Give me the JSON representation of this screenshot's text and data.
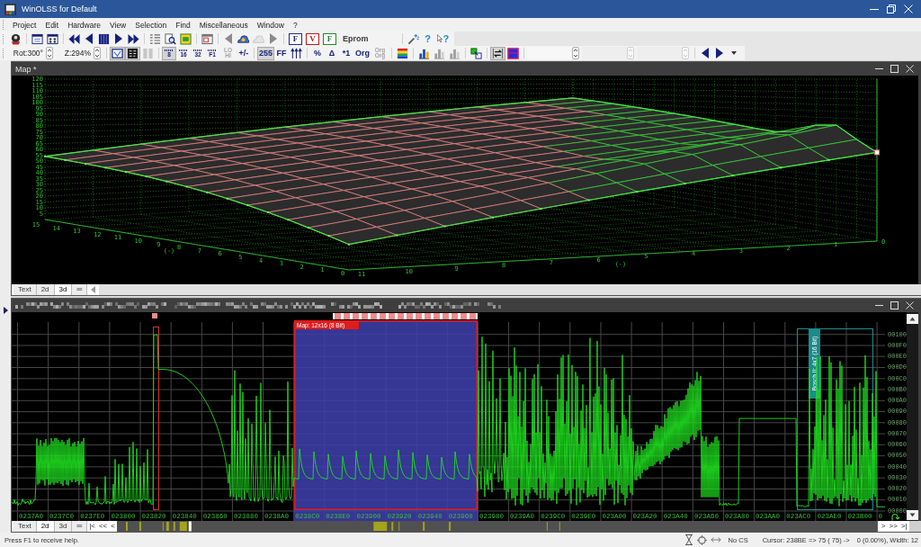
{
  "window": {
    "title": "WinOLSS for Default"
  },
  "menu": [
    "Project",
    "Edit",
    "Hardware",
    "View",
    "Selection",
    "Find",
    "Miscellaneous",
    "Window",
    "?"
  ],
  "toolbar_top": {
    "groups": [
      {
        "items": [
          {
            "kind": "icon",
            "pressed": false,
            "disabled": false
          }
        ]
      },
      {
        "items": [
          {
            "kind": "icon",
            "pressed": false,
            "disabled": false
          },
          {
            "kind": "icon",
            "pressed": false,
            "disabled": false
          }
        ]
      },
      {
        "items": [
          {
            "kind": "icon",
            "pressed": false,
            "disabled": false
          },
          {
            "kind": "icon",
            "pressed": false,
            "disabled": false
          },
          {
            "kind": "icon",
            "pressed": false,
            "disabled": false
          },
          {
            "kind": "icon",
            "pressed": false,
            "disabled": false
          },
          {
            "kind": "icon",
            "pressed": false,
            "disabled": false
          }
        ]
      },
      {
        "items": [
          {
            "kind": "icon",
            "pressed": false,
            "disabled": false
          },
          {
            "kind": "icon",
            "pressed": false,
            "disabled": false
          },
          {
            "kind": "icon",
            "pressed": false,
            "disabled": false
          }
        ]
      },
      {
        "items": [
          {
            "kind": "icon",
            "pressed": false,
            "disabled": false
          }
        ]
      },
      {
        "items": [
          {
            "kind": "icon",
            "pressed": false,
            "disabled": true
          },
          {
            "kind": "icon",
            "pressed": false,
            "disabled": false
          },
          {
            "kind": "icon",
            "pressed": false,
            "disabled": true
          },
          {
            "kind": "icon",
            "pressed": false,
            "disabled": true
          }
        ]
      },
      {
        "items": [
          {
            "kind": "letter",
            "label": "F",
            "color": "#1a2a8a",
            "pressed": false
          },
          {
            "kind": "letter",
            "label": "V",
            "color": "#c01818",
            "pressed": false
          },
          {
            "kind": "letter",
            "label": "F",
            "color": "#188a28",
            "pressed": false
          },
          {
            "kind": "text",
            "label": "Eprom"
          }
        ]
      },
      {
        "items": [
          {
            "kind": "icon",
            "pressed": false,
            "disabled": false
          },
          {
            "kind": "help",
            "label": "?",
            "pressed": false,
            "disabled": false
          },
          {
            "kind": "pointer_help",
            "label": "?",
            "pressed": false,
            "disabled": false
          }
        ]
      }
    ]
  },
  "toolbar_bottom": {
    "groups": [
      {
        "items": [
          {
            "kind": "spinner",
            "label": "Rot:300°",
            "disabled": false
          },
          {
            "kind": "spinner",
            "label": "Z:294%",
            "disabled": false
          }
        ]
      },
      {
        "items": [
          {
            "kind": "icon",
            "pressed": true,
            "disabled": false
          },
          {
            "kind": "icon",
            "pressed": true,
            "disabled": false
          },
          {
            "kind": "icon",
            "pressed": false,
            "disabled": true
          }
        ]
      },
      {
        "items": [
          {
            "kind": "bits",
            "label": "8",
            "pressed": true,
            "disabled": false
          },
          {
            "kind": "bits",
            "label": "16",
            "pressed": false,
            "disabled": false
          },
          {
            "kind": "bits",
            "label": "32",
            "pressed": false,
            "disabled": false
          },
          {
            "kind": "bits",
            "label": "F1",
            "pressed": false,
            "disabled": false
          },
          {
            "kind": "small",
            "label": "LO HI",
            "pressed": false,
            "disabled": true
          },
          {
            "kind": "symbol",
            "label": "+/-",
            "pressed": false,
            "disabled": false
          }
        ]
      },
      {
        "items": [
          {
            "kind": "symbol",
            "label": "255",
            "pressed": true,
            "disabled": false
          },
          {
            "kind": "symbol",
            "label": "FF",
            "pressed": false,
            "disabled": false
          },
          {
            "kind": "icon",
            "pressed": false,
            "disabled": false
          }
        ]
      },
      {
        "items": [
          {
            "kind": "symbol",
            "label": "%",
            "pressed": false,
            "disabled": false
          },
          {
            "kind": "symbol",
            "label": "Δ",
            "pressed": false,
            "disabled": false
          },
          {
            "kind": "symbol",
            "label": "*1",
            "pressed": false,
            "disabled": false
          },
          {
            "kind": "symbol",
            "label": "Org",
            "pressed": false,
            "disabled": false
          },
          {
            "kind": "small",
            "label": "Org Org",
            "pressed": false,
            "disabled": true
          }
        ]
      },
      {
        "items": [
          {
            "kind": "icon",
            "pressed": false,
            "disabled": false
          }
        ]
      },
      {
        "items": [
          {
            "kind": "icon",
            "pressed": false,
            "disabled": false
          },
          {
            "kind": "icon",
            "pressed": false,
            "disabled": true
          },
          {
            "kind": "icon",
            "pressed": false,
            "disabled": true
          }
        ]
      },
      {
        "items": [
          {
            "kind": "icon",
            "pressed": false,
            "disabled": false
          }
        ]
      },
      {
        "items": [
          {
            "kind": "icon",
            "pressed": true,
            "disabled": false
          },
          {
            "kind": "icon",
            "pressed": false,
            "disabled": false
          }
        ]
      },
      {
        "items": [
          {
            "kind": "spinner",
            "disabled": false
          },
          {
            "kind": "spinner",
            "disabled": true
          },
          {
            "kind": "spinner",
            "disabled": true
          }
        ]
      },
      {
        "items": [
          {
            "kind": "icon",
            "pressed": false,
            "disabled": false
          },
          {
            "kind": "icon",
            "pressed": false,
            "disabled": false
          },
          {
            "kind": "icon",
            "pressed": false,
            "disabled": false
          }
        ]
      }
    ]
  },
  "map_window": {
    "title": "Map *",
    "surface_plot": {
      "z_ticks": [
        "120",
        "115",
        "110",
        "105",
        "100",
        "95",
        "90",
        "85",
        "80",
        "75",
        "70",
        "65",
        "60",
        "55",
        "50",
        "45",
        "40",
        "35",
        "30",
        "25",
        "20",
        "15",
        "10",
        "5"
      ],
      "left_ticks": [
        "15",
        "14",
        "13",
        "12",
        "11",
        "10",
        "9",
        "8",
        "7",
        "6",
        "5",
        "4",
        "3",
        "2",
        "1",
        "0"
      ],
      "left_title": "(-)",
      "right_ticks": [
        "11",
        "10",
        "9",
        "8",
        "7",
        "6",
        "5",
        "4",
        "3",
        "2",
        "1",
        "0"
      ],
      "right_title": "(-)"
    },
    "tabs": [
      {
        "label": "Text",
        "selected": false
      },
      {
        "label": "2d",
        "selected": false
      },
      {
        "label": "3d",
        "selected": true
      },
      {
        "label": "═",
        "selected": false
      }
    ]
  },
  "hex_window": {
    "graph": {
      "maps": [
        {
          "kind": "selection",
          "label": "Map: 12x16 (8 Bit)"
        },
        {
          "kind": "outline",
          "label": "Bosch II: 4x7 (16 Bit)"
        }
      ],
      "y_ticks": [
        "00100",
        "000F0",
        "000E0",
        "000D0",
        "000C0",
        "000B0",
        "000A0",
        "00090",
        "00080",
        "00070",
        "00060",
        "00050",
        "00040",
        "00030",
        "00020",
        "00010",
        "00000"
      ],
      "x_ticks": [
        "0237A0",
        "0237C0",
        "0237E0",
        "023800",
        "023820",
        "023840",
        "023860",
        "023880",
        "0238A0",
        "0238C0",
        "0238E0",
        "023900",
        "023920",
        "023940",
        "023960",
        "023980",
        "0239A0",
        "0239C0",
        "0239E0",
        "023A00",
        "023A20",
        "023A40",
        "023A60",
        "023A80",
        "023AA0",
        "023AC0",
        "023AE0",
        "023B00",
        "0"
      ]
    },
    "tabs": [
      {
        "label": "Text",
        "selected": false
      },
      {
        "label": "2d",
        "selected": true
      },
      {
        "label": "3d",
        "selected": false
      },
      {
        "label": "═",
        "selected": false
      }
    ],
    "nav_left": [
      "|<",
      "<<",
      "<"
    ],
    "nav_right": [
      ">",
      ">>",
      ">|"
    ]
  },
  "status_bar": {
    "help": "Press F1 to receive help.",
    "checksum": "No CS",
    "cursor": "Cursor: 238BE => 75 ( 75) ->",
    "value": "0 (0.00%), Width: 12"
  }
}
